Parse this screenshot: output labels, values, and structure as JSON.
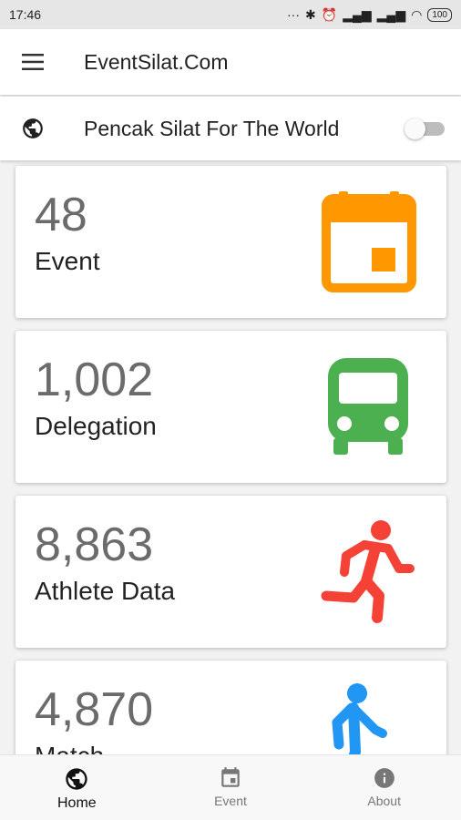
{
  "status_bar": {
    "time": "17:46",
    "battery": "100"
  },
  "app_bar": {
    "title": "EventSilat.Com"
  },
  "sub_bar": {
    "title": "Pencak Silat For The World",
    "toggle_on": false
  },
  "cards": [
    {
      "value": "48",
      "label": "Event",
      "icon": "calendar-icon",
      "color": "#FF9800"
    },
    {
      "value": "1,002",
      "label": "Delegation",
      "icon": "bus-icon",
      "color": "#4CAF50"
    },
    {
      "value": "8,863",
      "label": "Athlete Data",
      "icon": "runner-icon",
      "color": "#F44336"
    },
    {
      "value": "4,870",
      "label": "Match",
      "icon": "walker-icon",
      "color": "#2196F3"
    }
  ],
  "bottom_nav": [
    {
      "label": "Home",
      "icon": "globe-icon",
      "active": true
    },
    {
      "label": "Event",
      "icon": "calendar-icon",
      "active": false
    },
    {
      "label": "About",
      "icon": "info-icon",
      "active": false
    }
  ]
}
